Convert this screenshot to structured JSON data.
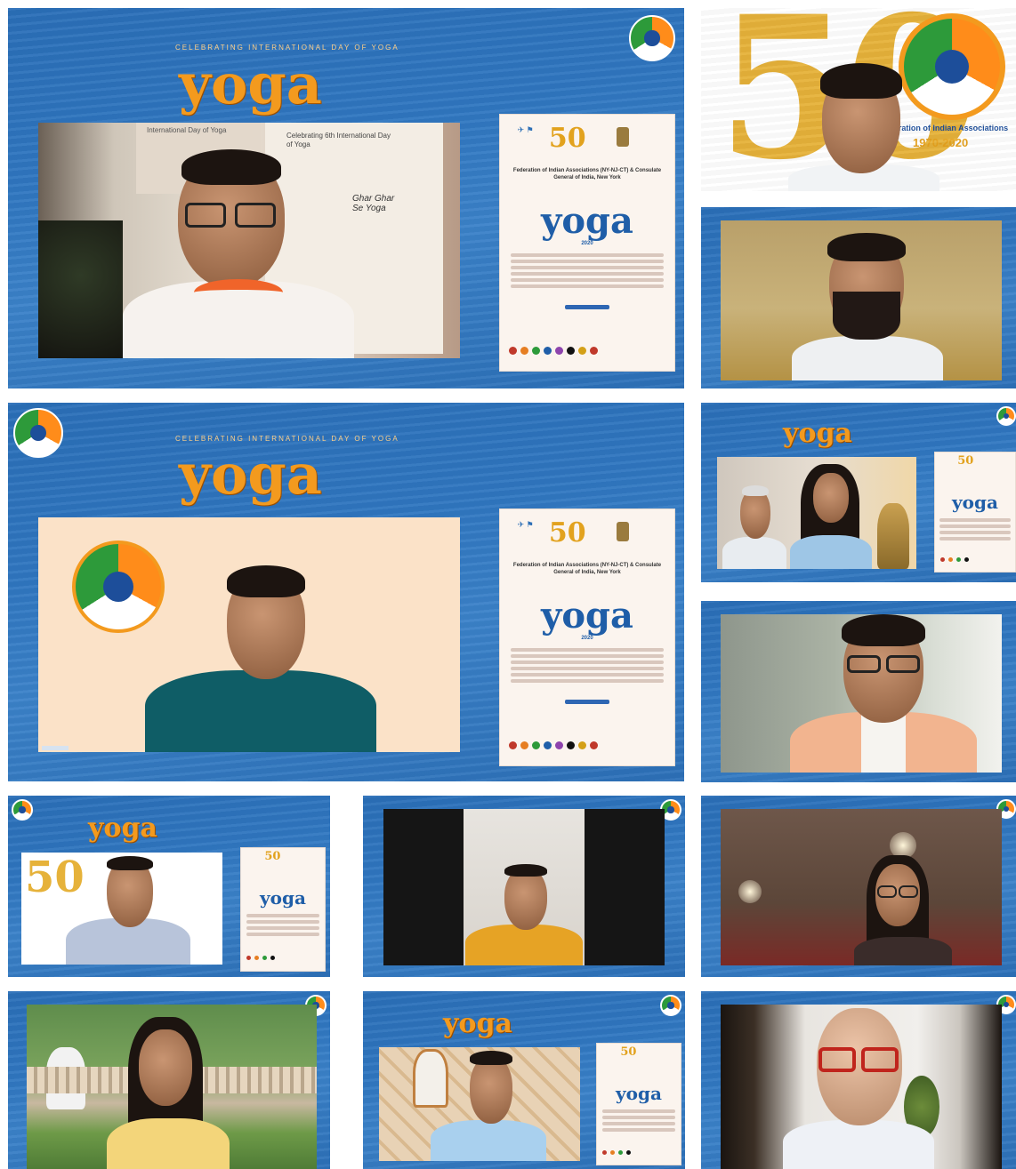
{
  "event": {
    "kicker": "Celebrating International Day of Yoga",
    "logo_text": "yoga",
    "poster_year": "2020",
    "poster_title": "Federation of Indian Associations (NY-NJ-CT) & Consulate General of India, New York",
    "poster_fifty": "50",
    "backdrop_text_1": "International Day of Yoga",
    "backdrop_text_2": "Celebrating 6th International Day of Yoga",
    "backdrop_text_3": "Ghar Ghar Se Yoga",
    "banner_org": "Federation of Indian Associations",
    "banner_years": "1970-2020",
    "banner_fifty": "50"
  },
  "colors": {
    "tile_blue": "#2f76c0",
    "logo_orange": "#f39a1e",
    "fia_saffron": "#ff8c1a",
    "fia_green": "#2d9a3a"
  },
  "participants": [
    {
      "tile": "tile-1",
      "shirt": "white-orange-collar"
    },
    {
      "tile": "tile-2",
      "shirt": "white"
    },
    {
      "tile": "tile-3",
      "shirt": "white"
    },
    {
      "tile": "tile-4",
      "shirt": "teal"
    },
    {
      "tile": "tile-5",
      "shirt": "white-and-light-blue"
    },
    {
      "tile": "tile-6",
      "shirt": "peach-vest"
    },
    {
      "tile": "tile-7",
      "shirt": "grey-vest"
    },
    {
      "tile": "tile-8",
      "shirt": "yellow"
    },
    {
      "tile": "tile-9",
      "shirt": "dark"
    },
    {
      "tile": "tile-10",
      "shirt": "yellow"
    },
    {
      "tile": "tile-11",
      "shirt": "light-blue"
    },
    {
      "tile": "tile-12",
      "shirt": "white"
    }
  ]
}
